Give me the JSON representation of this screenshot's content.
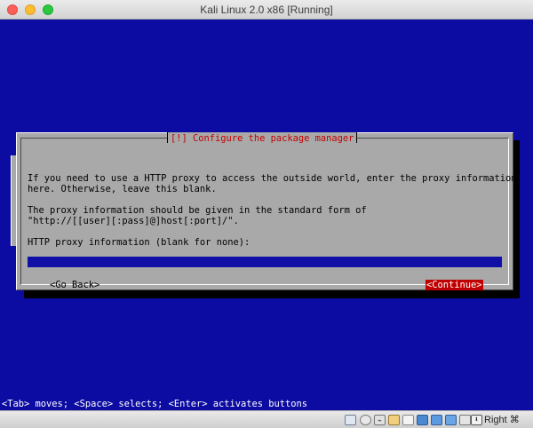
{
  "window": {
    "title": "Kali Linux 2.0 x86 [Running]"
  },
  "dialog": {
    "title": "[!] Configure the package manager",
    "lines": [
      "If you need to use a HTTP proxy to access the outside world, enter the proxy information",
      "here. Otherwise, leave this blank.",
      "The proxy information should be given in the standard form of",
      "\"http://[[user][:pass]@]host[:port]/\"."
    ],
    "field_label": "HTTP proxy information (blank for none):",
    "field_value": "",
    "go_back_label": "<Go Back>",
    "continue_label": "<Continue>"
  },
  "statusline": "<Tab> moves; <Space> selects; <Enter> activates buttons",
  "vbox_status": {
    "icons": [
      "hard-disk-icon",
      "optical-drive-icon",
      "usb-icon",
      "shared-folder-icon",
      "display-icon",
      "network-icon",
      "capture-icon",
      "recording-icon",
      "cpu-icon",
      "keyboard-capture-icon"
    ],
    "host_key": "Right ⌘"
  },
  "colors": {
    "screen_bg": "#0c0ca2",
    "dialog_bg": "#a9a9a9",
    "title_red": "#c40000",
    "selected_button_bg": "#c00000",
    "input_bg": "#1010a6"
  }
}
